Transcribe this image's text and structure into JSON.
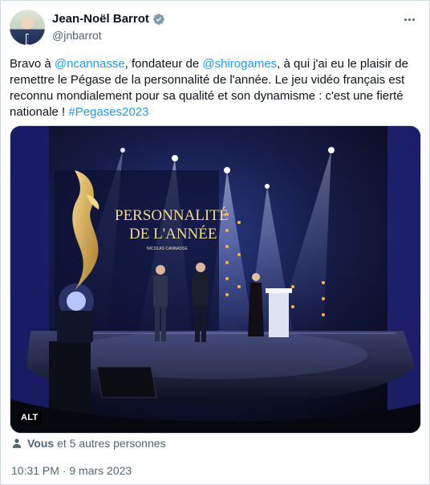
{
  "author": {
    "display_name": "Jean-Noël Barrot",
    "handle": "@jnbarrot",
    "verified": true
  },
  "tweet": {
    "t1": "Bravo à ",
    "mention1": "@ncannasse",
    "t2": ", fondateur de ",
    "mention2": "@shirogames",
    "t3": ", à qui j'ai eu le plaisir de remettre le Pégase de la personnalité de l'année. Le jeu vidéo français est reconnu mondialement pour sa qualité et son dynamisme : c'est une fierté nationale ! ",
    "hashtag": "#Pegases2023"
  },
  "media": {
    "alt_badge": "ALT",
    "stage_title_line1": "PERSONNALITÉ",
    "stage_title_line2": "DE L'ANNÉE",
    "stage_subtitle": "NICOLAS CANNASSE"
  },
  "likes": {
    "you": "Vous",
    "rest": "et 5 autres personnes"
  },
  "timestamp": "10:31 PM · 9 mars 2023",
  "colors": {
    "link": "#1d9bf0",
    "secondary_text": "#536471",
    "verified_badge": "#829aab"
  },
  "icons": [
    "verified-badge-icon",
    "more-options-icon",
    "person-icon"
  ]
}
